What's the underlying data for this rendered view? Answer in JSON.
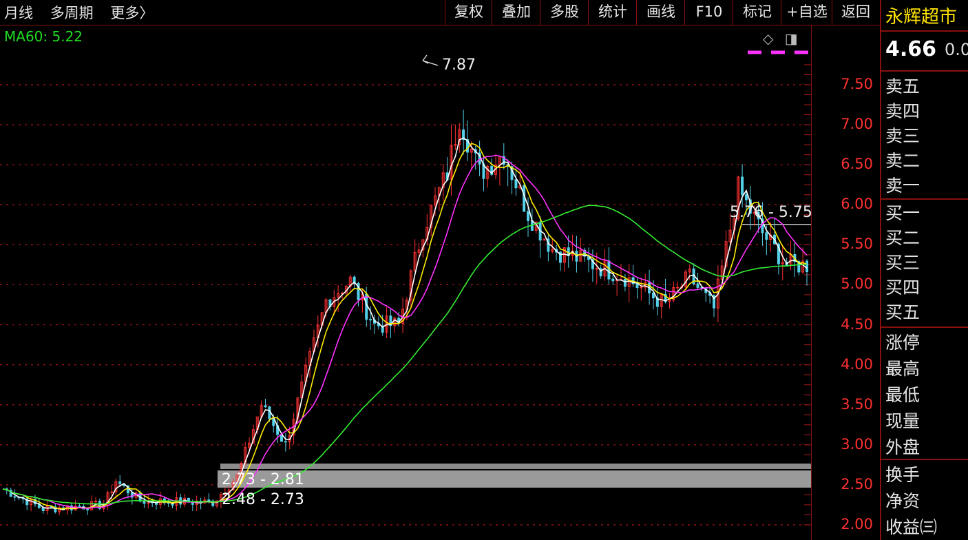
{
  "toolbar": {
    "left": [
      "月线",
      "多周期",
      "更多〉"
    ],
    "buttons": [
      "复权",
      "叠加",
      "多股",
      "统计",
      "画线",
      "F10",
      "标记",
      "+自选",
      "返回"
    ]
  },
  "indicator": {
    "ma60_label": "MA60: 5.22"
  },
  "chart_data": {
    "type": "candlestick",
    "y_axis_ticks": [
      "7.50",
      "7.00",
      "6.50",
      "6.00",
      "5.50",
      "5.00",
      "4.50",
      "4.00",
      "3.50",
      "3.00",
      "2.50",
      "2.00"
    ],
    "ylim": [
      1.8,
      8.3
    ],
    "annotations": {
      "peak": "7.87",
      "range_right": "5.76 - 5.75",
      "band_upper": "2.73 - 2.81",
      "band_lower": "2.48 - 2.73"
    },
    "colors": {
      "up": "#ff3232",
      "down": "#54d0e8",
      "ma_white": "#ffffff",
      "ma_yellow": "#ffee00",
      "ma_magenta": "#ff33ff",
      "ma60": "#33ee33",
      "grid": "#b01818"
    }
  },
  "quote_panel": {
    "name": "永辉超市",
    "price": "4.66",
    "change": "0.0",
    "order_book": [
      "卖五",
      "卖四",
      "卖三",
      "卖二",
      "卖一",
      "买一",
      "买二",
      "买三",
      "买四",
      "买五"
    ],
    "stats": [
      "涨停",
      "最高",
      "最低",
      "现量",
      "外盘"
    ],
    "extra": [
      "换手",
      "净资",
      "收益㈢"
    ]
  }
}
